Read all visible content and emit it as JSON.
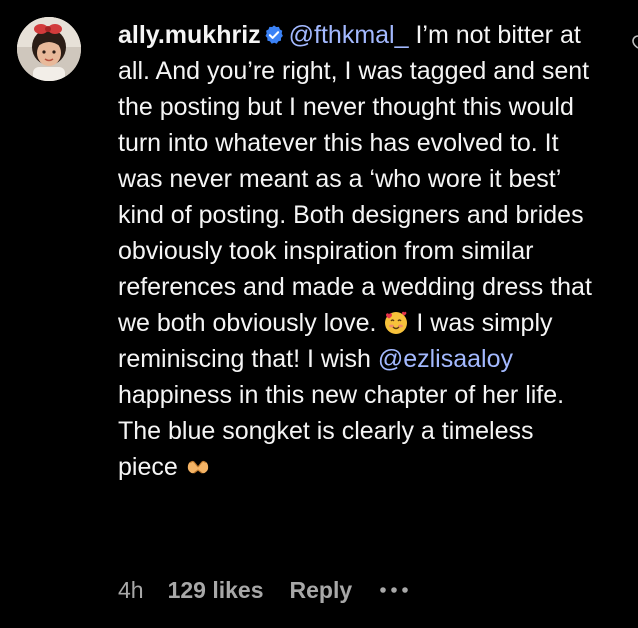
{
  "comment": {
    "username": "ally.mukhriz",
    "verified_icon": "verified-badge-icon",
    "mention_1": "@fthkmal_",
    "text_1": " I’m not bitter at all. And you’re right, I was tagged and sent the posting but I never thought this would turn into whatever this has evolved to. It was never meant as a ‘who wore it best’ kind of posting. Both designers and brides obviously took inspiration from similar references and made a wedding dress that we both obviously love. ",
    "emoji_1": "smiling-face-with-hearts",
    "text_2": " I was simply reminiscing that! I wish ",
    "mention_2": "@ezlisaaloy",
    "text_3": " happiness in this new chapter of her life. The blue songket is clearly a timeless piece ",
    "emoji_2": "heart-hands",
    "time": "4h",
    "likes": "129 likes",
    "reply_label": "Reply",
    "more_icon": "more-horizontal-icon"
  },
  "colors": {
    "background": "#000000",
    "text": "#f5f5f5",
    "mention": "#a3b9ff",
    "meta": "#a8a8a8",
    "verified": "#3b82f6"
  }
}
